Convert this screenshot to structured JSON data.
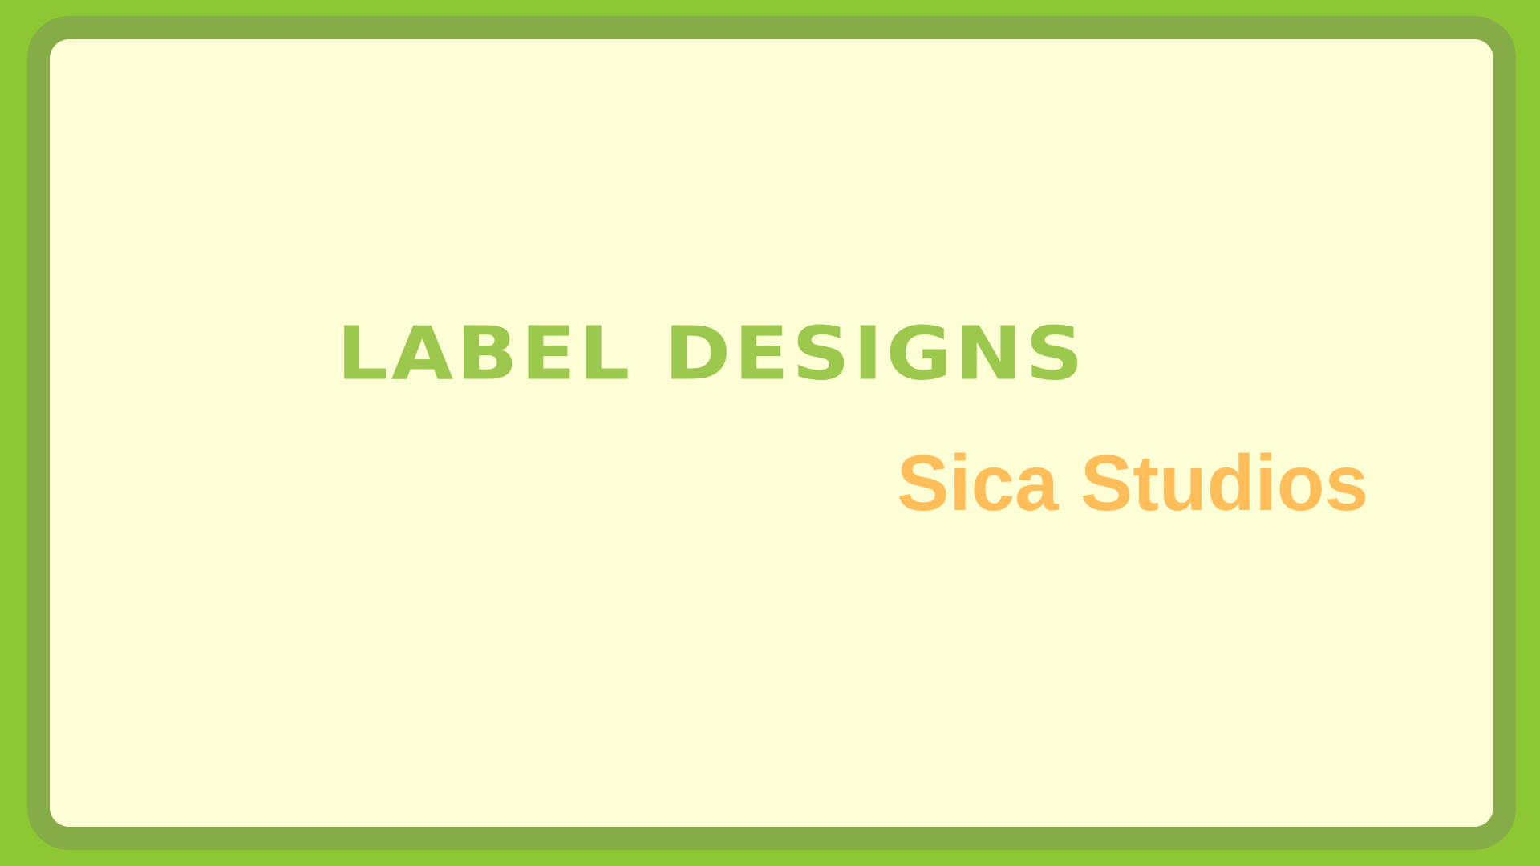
{
  "slide": {
    "title": "LABEL DESIGNS",
    "subtitle": "Sica Studios"
  },
  "colors": {
    "background": "#8CC833",
    "frame": "#85AC46",
    "panel": "#FEFED6",
    "title": "#9CC84E",
    "subtitle": "#FFBE5A"
  }
}
